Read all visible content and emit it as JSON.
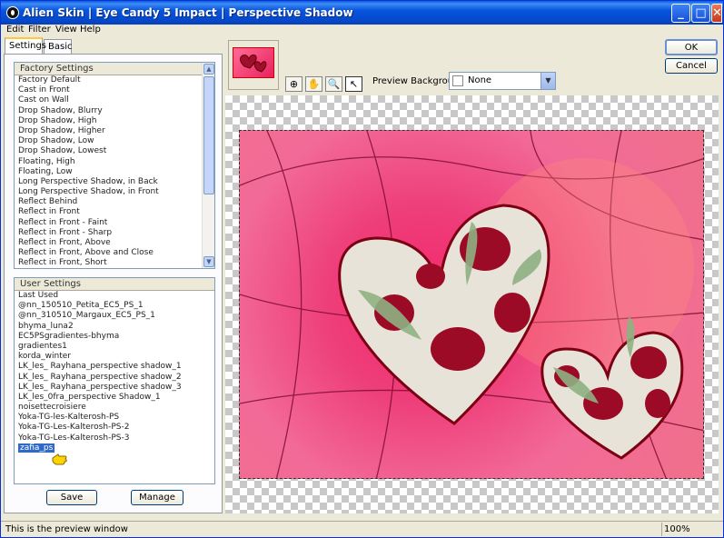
{
  "window": {
    "title": "Alien Skin  |  Eye Candy 5 Impact  |  Perspective Shadow",
    "controls": {
      "minimize": "_",
      "maximize": "□",
      "close": "✕"
    }
  },
  "menu": [
    "Edit",
    "Filter",
    "View",
    "Help"
  ],
  "tabs": [
    {
      "label": "Settings",
      "active": true
    },
    {
      "label": "Basic",
      "active": false
    }
  ],
  "factory": {
    "header": "Factory Settings",
    "items": [
      "Factory Default",
      "Cast in Front",
      "Cast on Wall",
      "Drop Shadow, Blurry",
      "Drop Shadow, High",
      "Drop Shadow, Higher",
      "Drop Shadow, Low",
      "Drop Shadow, Lowest",
      "Floating, High",
      "Floating, Low",
      "Long Perspective Shadow, in Back",
      "Long Perspective Shadow, in Front",
      "Reflect Behind",
      "Reflect in Front",
      "Reflect in Front - Faint",
      "Reflect in Front - Sharp",
      "Reflect in Front, Above",
      "Reflect in Front, Above and Close",
      "Reflect in Front, Short"
    ]
  },
  "user": {
    "header": "User Settings",
    "items": [
      "Last Used",
      "@nn_150510_Petita_EC5_PS_1",
      "@nn_310510_Margaux_EC5_PS_1",
      "bhyma_luna2",
      "EC5PSgradientes-bhyma",
      "gradientes1",
      "korda_winter",
      "LK_les_ Rayhana_perspective shadow_1",
      "LK_les_ Rayhana_perspective shadow_2",
      "LK_les_ Rayhana_perspective shadow_3",
      "LK_les_0fra_perspective Shadow_1",
      "noisettecroisiere",
      "Yoka-TG-les-Kalterosh-PS",
      "Yoka-TG-Les-Kalterosh-PS-2",
      "Yoka-TG-Les-Kalterosh-PS-3",
      "zafia_ps"
    ],
    "selected": 15
  },
  "buttons": {
    "save": "Save",
    "manage": "Manage",
    "ok": "OK",
    "cancel": "Cancel"
  },
  "preview": {
    "background_label": "Preview Background:",
    "background_value": "None"
  },
  "status": {
    "text": "This is the preview window",
    "zoom": "100%"
  }
}
